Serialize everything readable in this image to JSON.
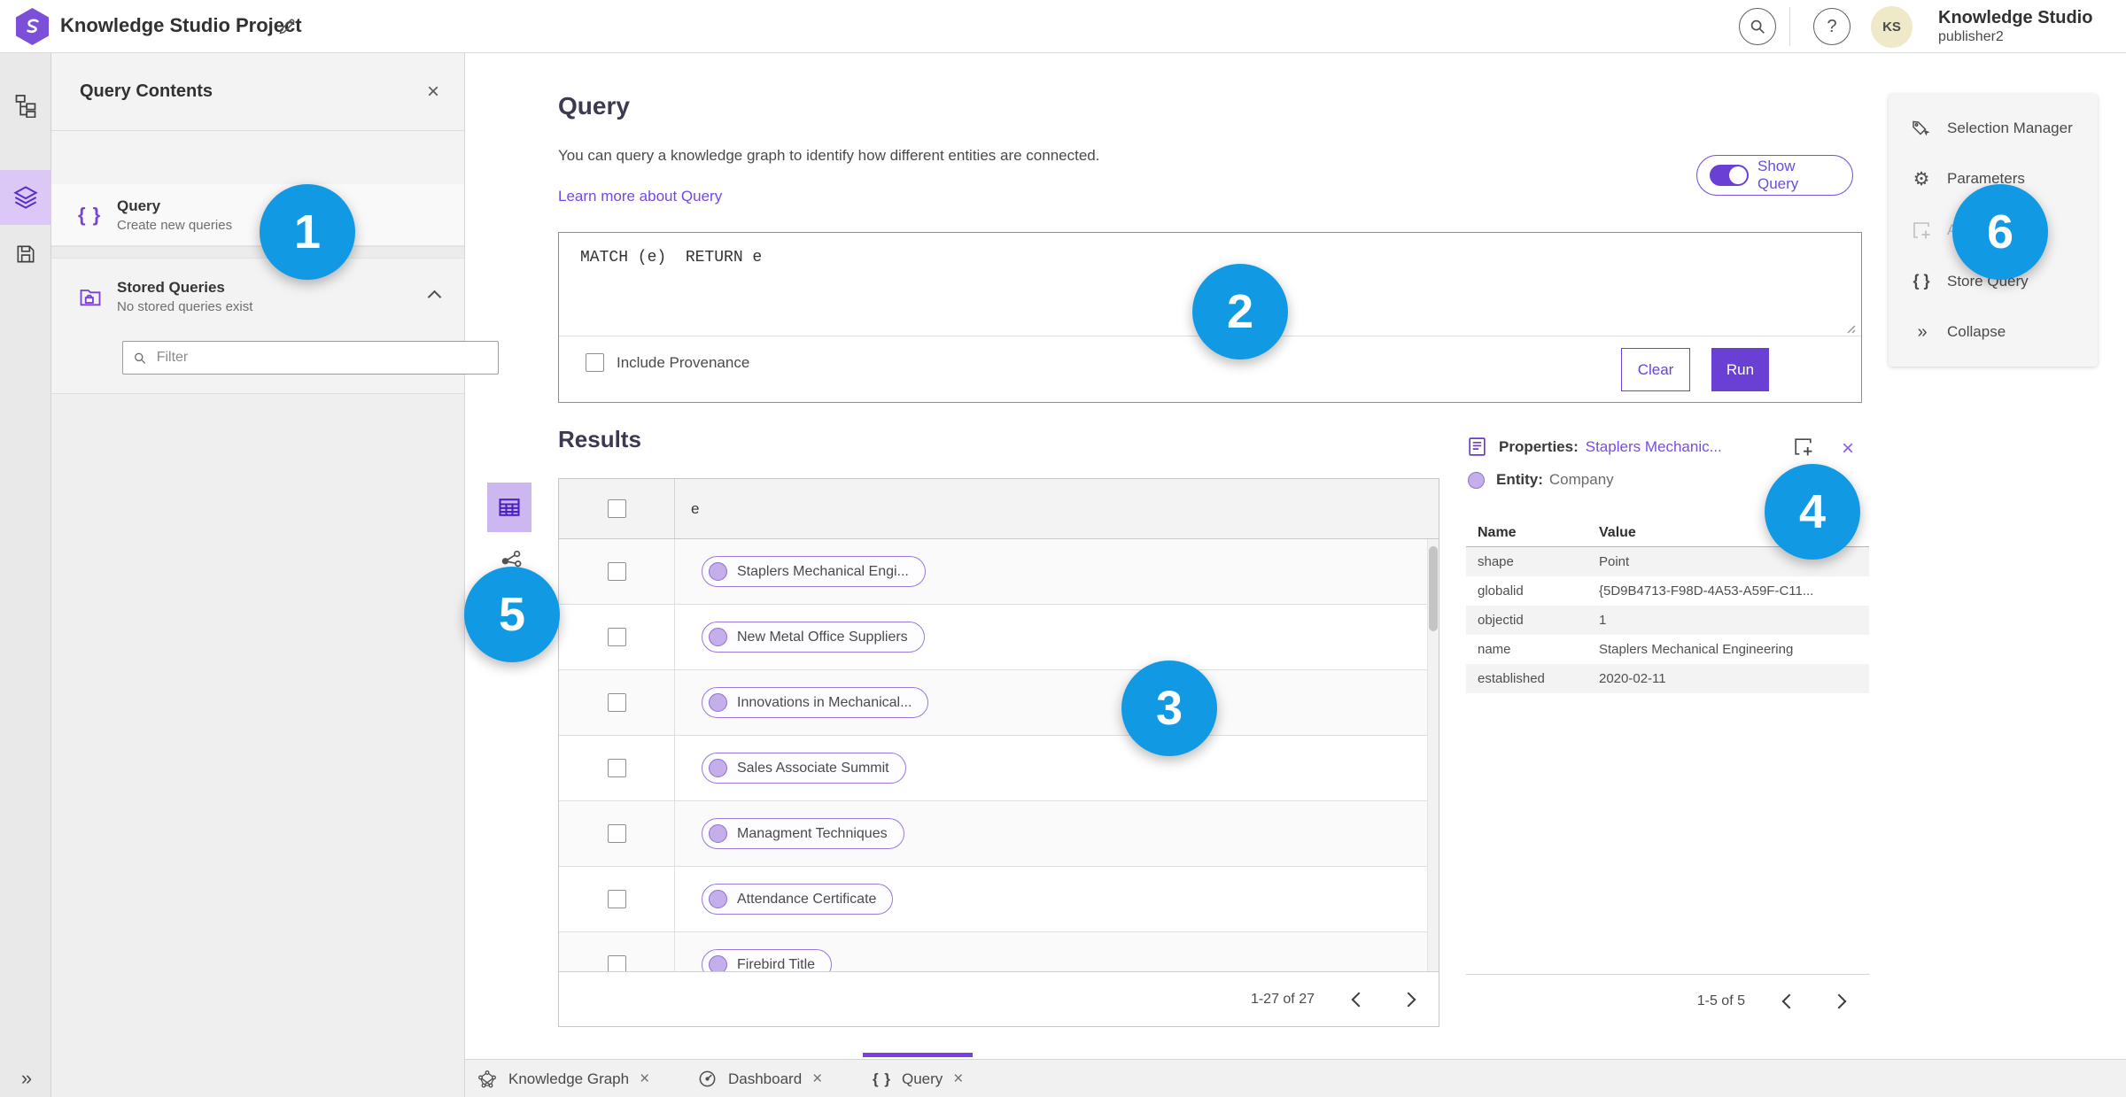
{
  "header": {
    "title": "Knowledge Studio Project",
    "user": {
      "initials": "KS",
      "name": "Knowledge Studio",
      "role": "publisher2",
      "help": "?"
    }
  },
  "contents_panel": {
    "title": "Query Contents",
    "close": "×",
    "query_item": {
      "title": "Query",
      "subtitle": "Create new queries",
      "icon": "{ }"
    },
    "stored_item": {
      "title": "Stored Queries",
      "subtitle": "No stored queries exist"
    },
    "filter_placeholder": "Filter"
  },
  "query_panel": {
    "title": "Query",
    "description": "You can query a knowledge graph to identify how different entities are connected.",
    "learn_more": "Learn more about Query",
    "show_query": "Show Query",
    "code": "MATCH (e)  RETURN e",
    "include_provenance": "Include Provenance",
    "clear": "Clear",
    "run": "Run"
  },
  "results": {
    "title": "Results",
    "column": "e",
    "rows": [
      "Staplers Mechanical Engi...",
      "New Metal Office Suppliers",
      "Innovations in Mechanical...",
      "Sales Associate Summit",
      "Managment Techniques",
      "Attendance Certificate",
      "Firebird Title"
    ],
    "pagination": "1-27 of 27"
  },
  "properties": {
    "label": "Properties:",
    "entity_link": "Staplers Mechanic...",
    "close": "×",
    "entity_label": "Entity:",
    "entity_type": "Company",
    "col_name": "Name",
    "col_value": "Value",
    "rows": [
      {
        "name": "shape",
        "value": "Point"
      },
      {
        "name": "globalid",
        "value": "{5D9B4713-F98D-4A53-A59F-C11..."
      },
      {
        "name": "objectid",
        "value": "1"
      },
      {
        "name": "name",
        "value": "Staplers Mechanical Engineering"
      },
      {
        "name": "established",
        "value": "2020-02-11"
      }
    ],
    "pagination": "1-5 of 5"
  },
  "right_menu": {
    "items": [
      {
        "label": "Selection Manager"
      },
      {
        "label": "Parameters"
      },
      {
        "label": "Add To Map"
      },
      {
        "label": "Store Query"
      },
      {
        "label": "Collapse"
      }
    ],
    "braces_icon": "{ }",
    "collapse_icon": "»"
  },
  "bottom_tabs": {
    "close": "×",
    "tabs": [
      {
        "label": "Knowledge Graph"
      },
      {
        "label": "Dashboard"
      },
      {
        "label": "Query"
      }
    ],
    "query_icon": "{ }"
  },
  "rail": {
    "expand_icon": "»"
  },
  "annotations": [
    "1",
    "2",
    "3",
    "4",
    "5",
    "6"
  ],
  "colors": {
    "accent": "#6a42d4",
    "callout_blue": "#119ae3",
    "chip_fill": "#c5afeb",
    "chip_border": "#9b78de"
  }
}
